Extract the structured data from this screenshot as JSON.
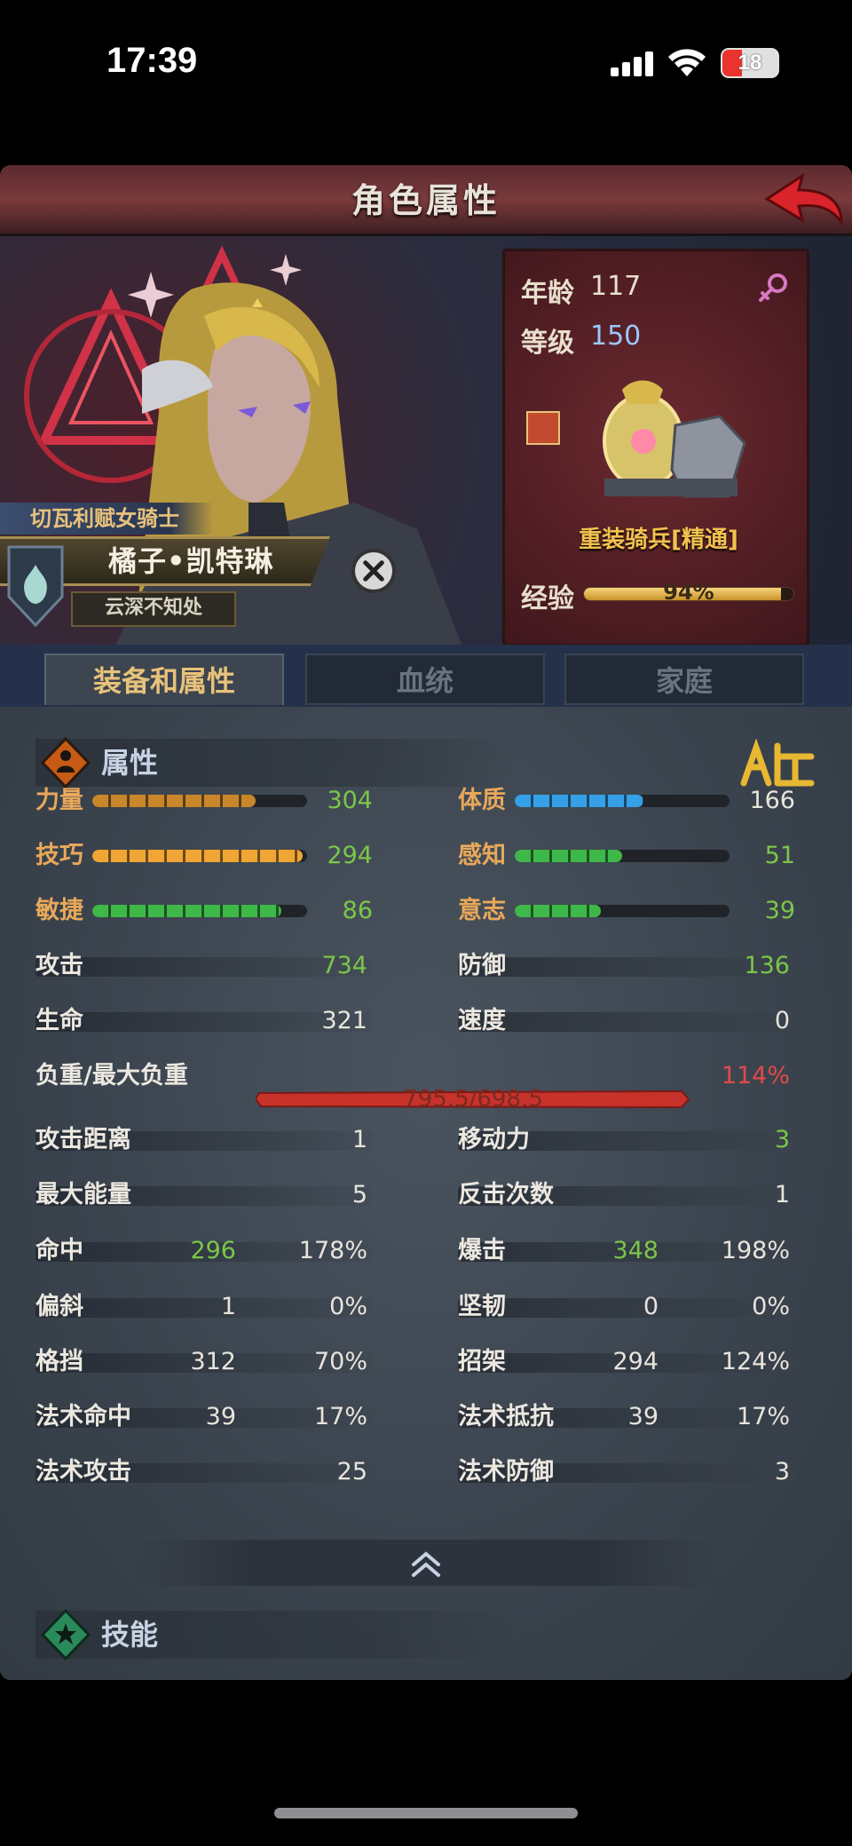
{
  "status_bar": {
    "time": "17:39",
    "battery": "18"
  },
  "header": {
    "title": "角色属性"
  },
  "character": {
    "class_title": "切瓦利赋女骑士",
    "name": "橘子•凯特琳",
    "subtitle": "云深不知处"
  },
  "info": {
    "age_label": "年龄",
    "age": "117",
    "level_label": "等级",
    "level": "150",
    "unit_name": "重装骑兵[精通]",
    "exp_label": "经验",
    "exp_text": "94%",
    "exp_fraction": 0.94
  },
  "tabs": [
    {
      "label": "装备和属性",
      "active": true
    },
    {
      "label": "血统",
      "active": false
    },
    {
      "label": "家庭",
      "active": false
    }
  ],
  "sections": {
    "attributes": "属性",
    "skills": "技能"
  },
  "attributes": [
    {
      "label": "力量",
      "value": "304",
      "fill": 0.76,
      "color": "#c9862a"
    },
    {
      "label": "技巧",
      "value": "294",
      "fill": 0.98,
      "color": "#f0a634"
    },
    {
      "label": "敏捷",
      "value": "86",
      "fill": 0.88,
      "color": "#3fb84a"
    },
    {
      "label": "体质",
      "value": "166",
      "fill": 0.6,
      "color": "#36a0e6"
    },
    {
      "label": "感知",
      "value": "51",
      "fill": 0.5,
      "color": "#3fb84a"
    },
    {
      "label": "意志",
      "value": "39",
      "fill": 0.4,
      "color": "#3fb84a"
    }
  ],
  "stats": {
    "attack_label": "攻击",
    "attack": "734",
    "defense_label": "防御",
    "defense": "136",
    "hp_label": "生命",
    "hp": "321",
    "speed_label": "速度",
    "speed": "0",
    "load_label": "负重/最大负重",
    "load_text": "795.5/698.5",
    "load_percent": "114%",
    "range_label": "攻击距离",
    "range": "1",
    "move_label": "移动力",
    "move": "3",
    "energy_label": "最大能量",
    "energy": "5",
    "counter_label": "反击次数",
    "counter": "1",
    "hit_label": "命中",
    "hit": "296",
    "hit_pct": "178%",
    "crit_label": "爆击",
    "crit": "348",
    "crit_pct": "198%",
    "deflect_label": "偏斜",
    "deflect": "1",
    "deflect_pct": "0%",
    "tough_label": "坚韧",
    "tough": "0",
    "tough_pct": "0%",
    "block_label": "格挡",
    "block": "312",
    "block_pct": "70%",
    "parry_label": "招架",
    "parry": "294",
    "parry_pct": "124%",
    "spell_hit_label": "法术命中",
    "spell_hit": "39",
    "spell_hit_pct": "17%",
    "spell_resist_label": "法术抵抗",
    "spell_resist": "39",
    "spell_resist_pct": "17%",
    "spell_atk_label": "法术攻击",
    "spell_atk": "25",
    "spell_def_label": "法术防御",
    "spell_def": "3"
  },
  "colors": {
    "accent_gold": "#e8c27a",
    "value_green": "#7bc64a",
    "overload_red": "#e24a4a"
  }
}
